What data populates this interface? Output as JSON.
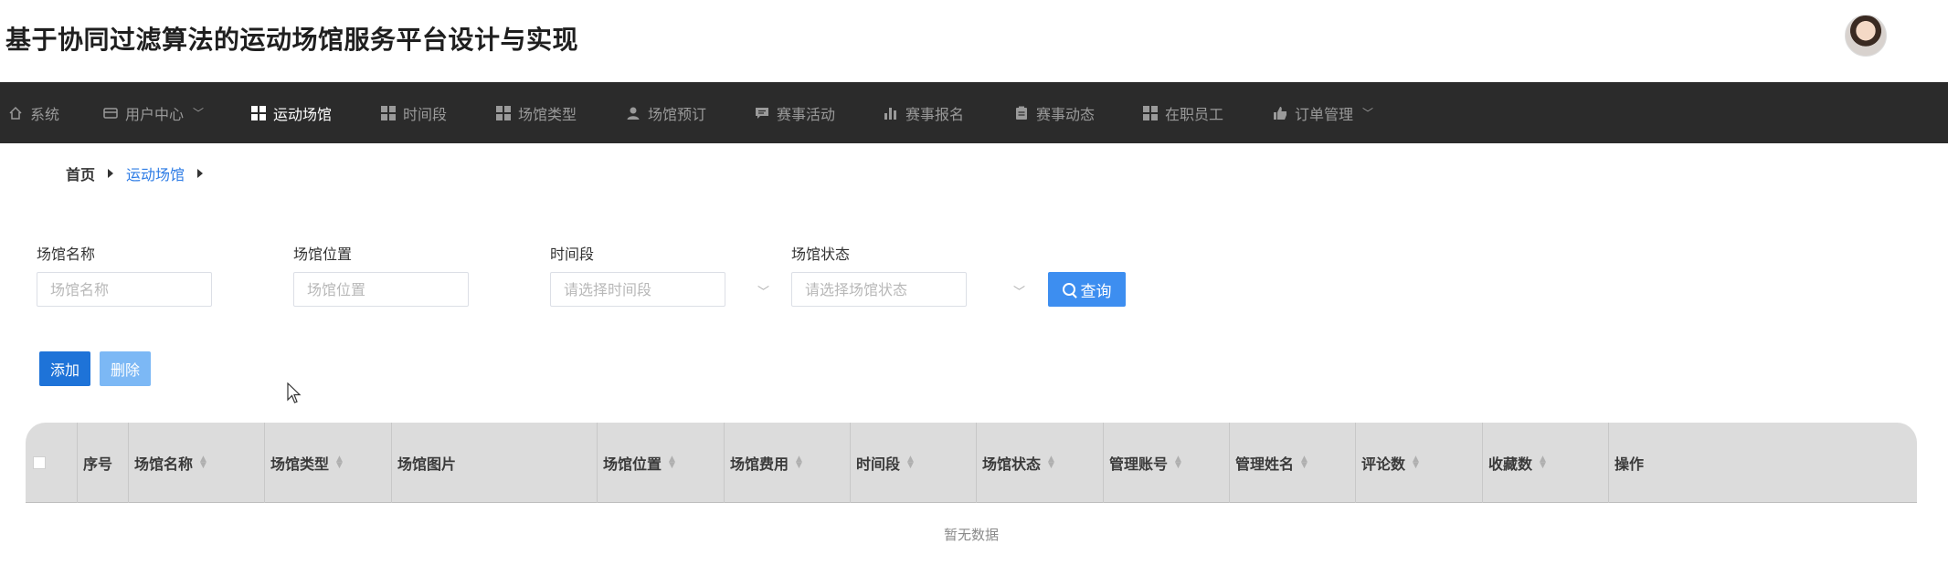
{
  "header": {
    "title": "基于协同过滤算法的运动场馆服务平台设计与实现"
  },
  "nav": {
    "items": [
      {
        "label": "系统",
        "icon": "home-icon",
        "active": false
      },
      {
        "label": "用户中心",
        "icon": "card-icon",
        "active": false,
        "dropdown": true
      },
      {
        "label": "运动场馆",
        "icon": "grid-icon",
        "active": true
      },
      {
        "label": "时间段",
        "icon": "grid-icon",
        "active": false
      },
      {
        "label": "场馆类型",
        "icon": "grid-icon",
        "active": false
      },
      {
        "label": "场馆预订",
        "icon": "user-icon",
        "active": false
      },
      {
        "label": "赛事活动",
        "icon": "chat-icon",
        "active": false
      },
      {
        "label": "赛事报名",
        "icon": "bar-chart-icon",
        "active": false
      },
      {
        "label": "赛事动态",
        "icon": "clipboard-icon",
        "active": false
      },
      {
        "label": "在职员工",
        "icon": "grid-icon",
        "active": false
      },
      {
        "label": "订单管理",
        "icon": "thumb-icon",
        "active": false,
        "dropdown": true
      }
    ]
  },
  "breadcrumb": {
    "home": "首页",
    "current": "运动场馆"
  },
  "filters": {
    "name": {
      "label": "场馆名称",
      "placeholder": "场馆名称"
    },
    "location": {
      "label": "场馆位置",
      "placeholder": "场馆位置"
    },
    "time": {
      "label": "时间段",
      "placeholder": "请选择时间段"
    },
    "status": {
      "label": "场馆状态",
      "placeholder": "请选择场馆状态"
    },
    "query_label": "查询"
  },
  "actions": {
    "add_label": "添加",
    "delete_label": "删除"
  },
  "table": {
    "columns": [
      "序号",
      "场馆名称",
      "场馆类型",
      "场馆图片",
      "场馆位置",
      "场馆费用",
      "时间段",
      "场馆状态",
      "管理账号",
      "管理姓名",
      "评论数",
      "收藏数",
      "操作"
    ],
    "empty_text": "暂无数据"
  },
  "colors": {
    "nav_bg": "#2b2b2b",
    "primary": "#3d8ef0",
    "add_button": "#1e73d8",
    "delete_button": "#7cb8f5",
    "breadcrumb_active": "#2c7be5"
  }
}
